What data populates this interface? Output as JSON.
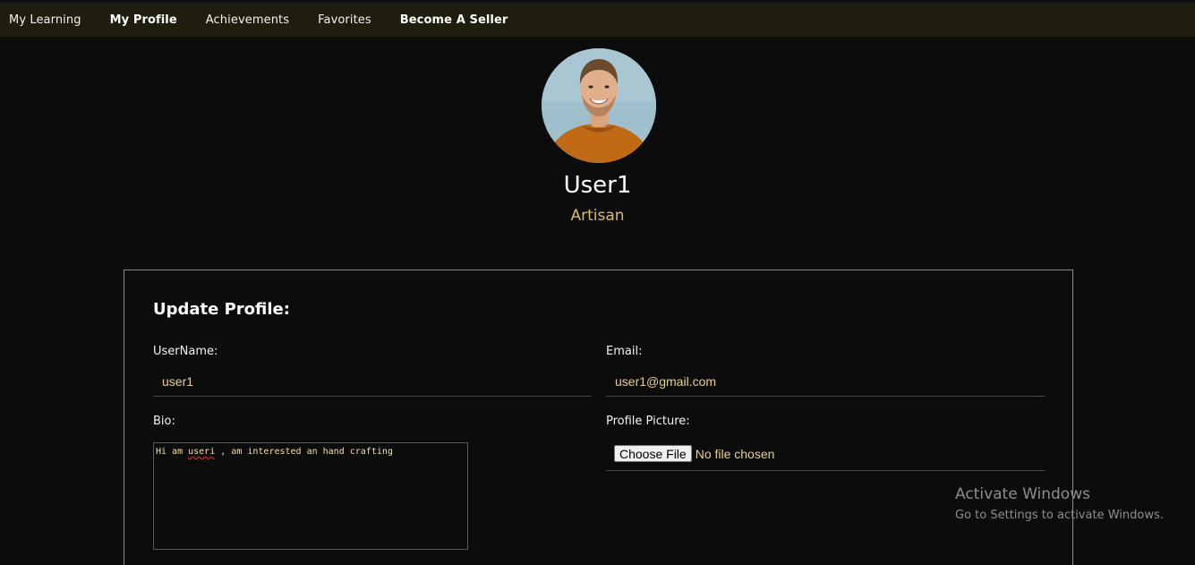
{
  "nav": {
    "items": [
      {
        "label": "My Learning"
      },
      {
        "label": "My Profile"
      },
      {
        "label": "Achievements"
      },
      {
        "label": "Favorites"
      },
      {
        "label": "Become A Seller"
      }
    ]
  },
  "profile": {
    "avatar_icon": "user-photo",
    "name": "User1",
    "role": "Artisan"
  },
  "update_form": {
    "title": "Update Profile:",
    "username_label": "UserName:",
    "username_value": "user1",
    "email_label": "Email:",
    "email_value": "user1@gmail.com",
    "bio_label": "Bio:",
    "bio_text_before": "Hi am ",
    "bio_text_misspelled": "useri",
    "bio_text_after": " , am interested an hand crafting",
    "picture_label": "Profile Picture:",
    "choose_file_label": "Choose File",
    "file_status": "No file chosen"
  },
  "watermark": {
    "title": "Activate Windows",
    "subtitle": "Go to Settings to activate Windows."
  },
  "colors": {
    "background": "#0c0c0c",
    "topbar": "#1e1d0e",
    "accent": "#d9bc6e"
  }
}
